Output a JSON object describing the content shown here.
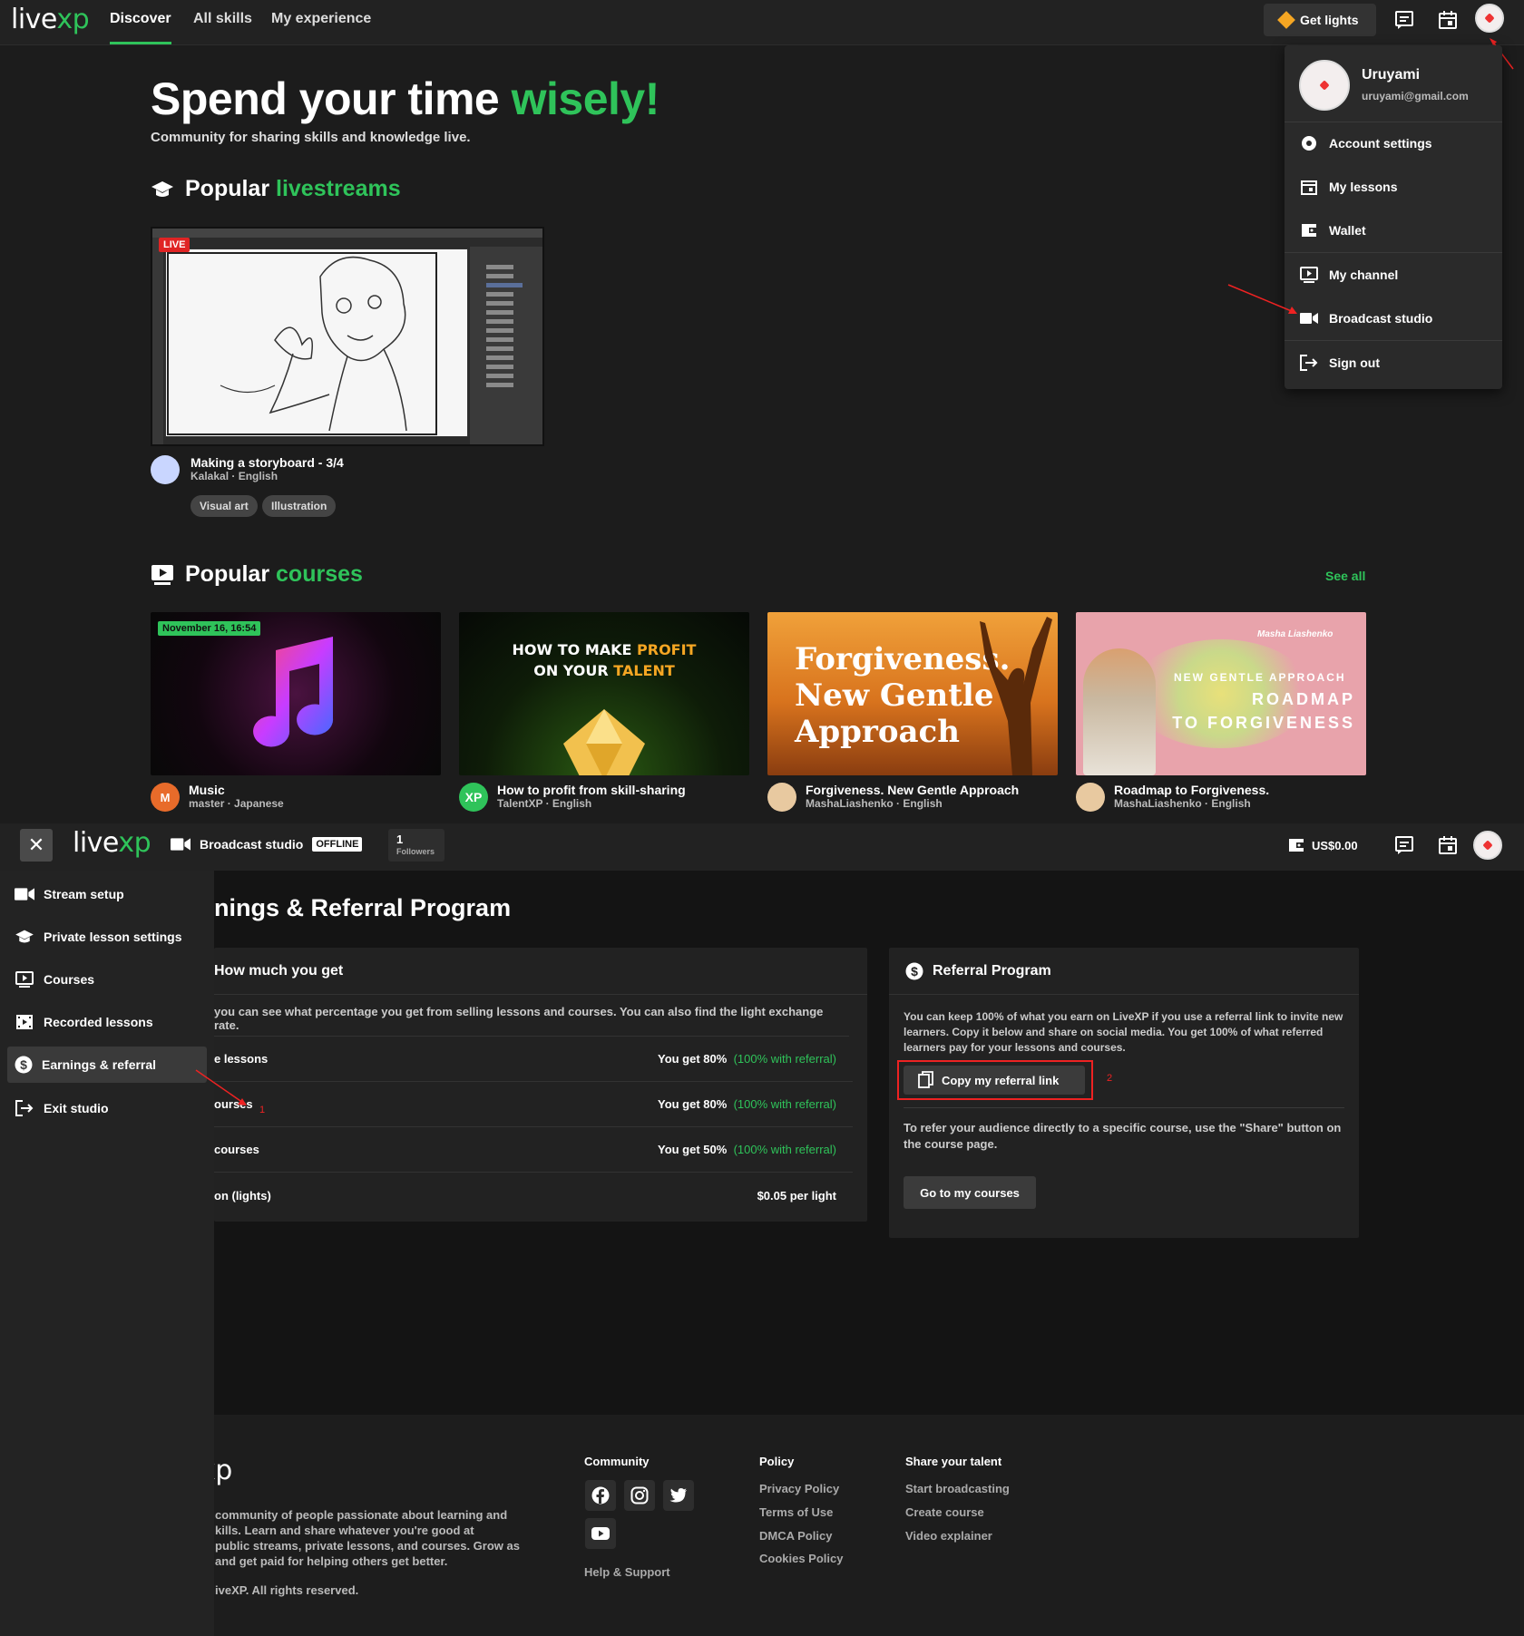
{
  "top": {
    "logo": {
      "part1": "live",
      "part2": "xp"
    },
    "nav": {
      "discover": "Discover",
      "all_skills": "All skills",
      "my_experience": "My experience"
    },
    "get_lights": "Get lights",
    "hero": {
      "title_main": "Spend your time ",
      "title_accent": "wisely!",
      "subtitle": "Community for sharing skills and knowledge live."
    },
    "livestreams": {
      "heading_main": "Popular ",
      "heading_accent": "livestreams",
      "card": {
        "live_badge": "LIVE",
        "title": "Making a storyboard - 3/4",
        "meta": "Kalakal · English",
        "tags": [
          "Visual art",
          "Illustration"
        ]
      }
    },
    "courses": {
      "heading_main": "Popular ",
      "heading_accent": "courses",
      "see_all": "See all",
      "items": [
        {
          "badge": "November 16, 16:54",
          "title": "Music",
          "meta": "master · Japanese",
          "avatar_letter": "M"
        },
        {
          "thumb_line1a": "HOW TO MAKE ",
          "thumb_line1b": "PROFIT",
          "thumb_line2a": "ON YOUR ",
          "thumb_line2b": "TALENT",
          "title": "How to profit from skill-sharing",
          "meta": "TalentXP · English",
          "avatar_letter": "XP"
        },
        {
          "thumb_text1": "Forgiveness.",
          "thumb_text2": "New Gentle",
          "thumb_text3": "Approach",
          "title": "Forgiveness. New Gentle Approach",
          "meta": "MashaLiashenko · English"
        },
        {
          "thumb_author": "Masha Liashenko",
          "thumb_line1": "NEW GENTLE APPROACH",
          "thumb_line2": "ROADMAP",
          "thumb_line3": "TO FORGIVENESS",
          "title": "Roadmap to Forgiveness.",
          "meta": "MashaLiashenko · English"
        }
      ]
    },
    "dropdown": {
      "user_name": "Uruyami",
      "user_email": "uruyami@gmail.com",
      "items": [
        "Account settings",
        "My lessons",
        "Wallet",
        "My channel",
        "Broadcast studio",
        "Sign out"
      ]
    }
  },
  "bottom": {
    "nav": {
      "close": "✕",
      "studio_label": "Broadcast studio",
      "status": "OFFLINE",
      "followers_count": "1",
      "followers_label": "Followers",
      "balance": "US$0.00"
    },
    "sidebar": [
      "Stream setup",
      "Private lesson settings",
      "Courses",
      "Recorded lessons",
      "Earnings & referral",
      "Exit studio"
    ],
    "page_title": "nings & Referral Program",
    "how_much": {
      "title": "How much you get",
      "intro": "you can see what percentage you get from selling lessons and courses. You can also find the light exchange rate.",
      "rows": [
        {
          "label": "e lessons",
          "value": "You get 80%",
          "bonus": "(100% with referral)"
        },
        {
          "label": "ourses",
          "value": "You get 80%",
          "bonus": "(100% with referral)"
        },
        {
          "label": "courses",
          "value": "You get 50%",
          "bonus": "(100% with referral)"
        },
        {
          "label": "on (lights)",
          "value": "$0.05 per light",
          "bonus": ""
        }
      ]
    },
    "referral": {
      "title": "Referral Program",
      "text": "You can keep 100% of what you earn on LiveXP if you use a referral link to invite new learners. Copy it below and share on social media. You get 100% of what referred learners pay for your lessons and courses.",
      "copy_button": "Copy my referral link",
      "text2": "To refer your audience directly to a specific course, use the \"Share\" button on the course page.",
      "go_button": "Go to my courses"
    },
    "annotations": {
      "one": "1",
      "two": "2"
    },
    "footer": {
      "logo_fragment": "xp",
      "about": [
        "community of people passionate about learning and",
        "kills. Learn and share whatever you're good at",
        "public streams, private lessons, and courses. Grow as",
        " and get paid for helping others get better."
      ],
      "copyright": "iveXP. All rights reserved.",
      "community": {
        "title": "Community",
        "help": "Help & Support"
      },
      "policy": {
        "title": "Policy",
        "links": [
          "Privacy Policy",
          "Terms of Use",
          "DMCA Policy",
          "Cookies Policy"
        ]
      },
      "share": {
        "title": "Share your talent",
        "links": [
          "Start broadcasting",
          "Create course",
          "Video explainer"
        ]
      }
    }
  },
  "colors": {
    "accent": "#2fc35a",
    "live": "#e02424",
    "annotation": "#e22222"
  }
}
